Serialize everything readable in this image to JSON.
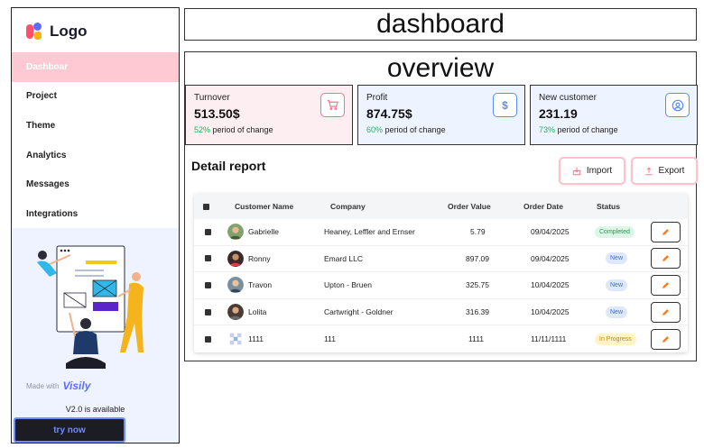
{
  "sidebar": {
    "logo_text": "Logo",
    "items": [
      {
        "label": "Dashboar",
        "active": true
      },
      {
        "label": "Project"
      },
      {
        "label": "Theme"
      },
      {
        "label": "Analytics"
      },
      {
        "label": "Messages"
      },
      {
        "label": "Integrations"
      }
    ],
    "made_with": "Made with",
    "brand": "Visily",
    "version_text": "V2.0 is available",
    "try_label": "try now"
  },
  "header": {
    "title": "dashboard"
  },
  "overview": {
    "title": "overview",
    "kpis": [
      {
        "label": "Turnover",
        "value": "513.50$",
        "pct": "52%",
        "change_text": " period of change",
        "icon": "cart-icon"
      },
      {
        "label": "Profit",
        "value": "874.75$",
        "pct": "60%",
        "change_text": " period of change",
        "icon": "dollar-icon"
      },
      {
        "label": "New customer",
        "value": "231.19",
        "pct": "73%",
        "change_text": " period of change",
        "icon": "user-circle-icon"
      }
    ]
  },
  "detail": {
    "title": "Detail report",
    "import_label": "Import",
    "export_label": "Export",
    "columns": [
      "Customer Name",
      "Company",
      "Order Value",
      "Order Date",
      "Status"
    ],
    "rows": [
      {
        "name": "Gabrielle",
        "company": "Heaney, Leffler and Ernser",
        "value": "5.79",
        "date": "09/04/2025",
        "status": "Completed"
      },
      {
        "name": "Ronny",
        "company": "Emard LLC",
        "value": "897.09",
        "date": "09/04/2025",
        "status": "New"
      },
      {
        "name": "Travon",
        "company": "Upton - Bruen",
        "value": "325.75",
        "date": "10/04/2025",
        "status": "New"
      },
      {
        "name": "Lolita",
        "company": "Cartwright - Goldner",
        "value": "316.39",
        "date": "10/04/2025",
        "status": "New"
      },
      {
        "name": "1111",
        "company": "111",
        "value": "1111",
        "date": "11/11/1111",
        "status": "In Progress"
      }
    ]
  },
  "colors": {
    "accent_pink": "#ffc9d3",
    "accent_blue": "#5b8cff",
    "positive": "#22b35e"
  }
}
